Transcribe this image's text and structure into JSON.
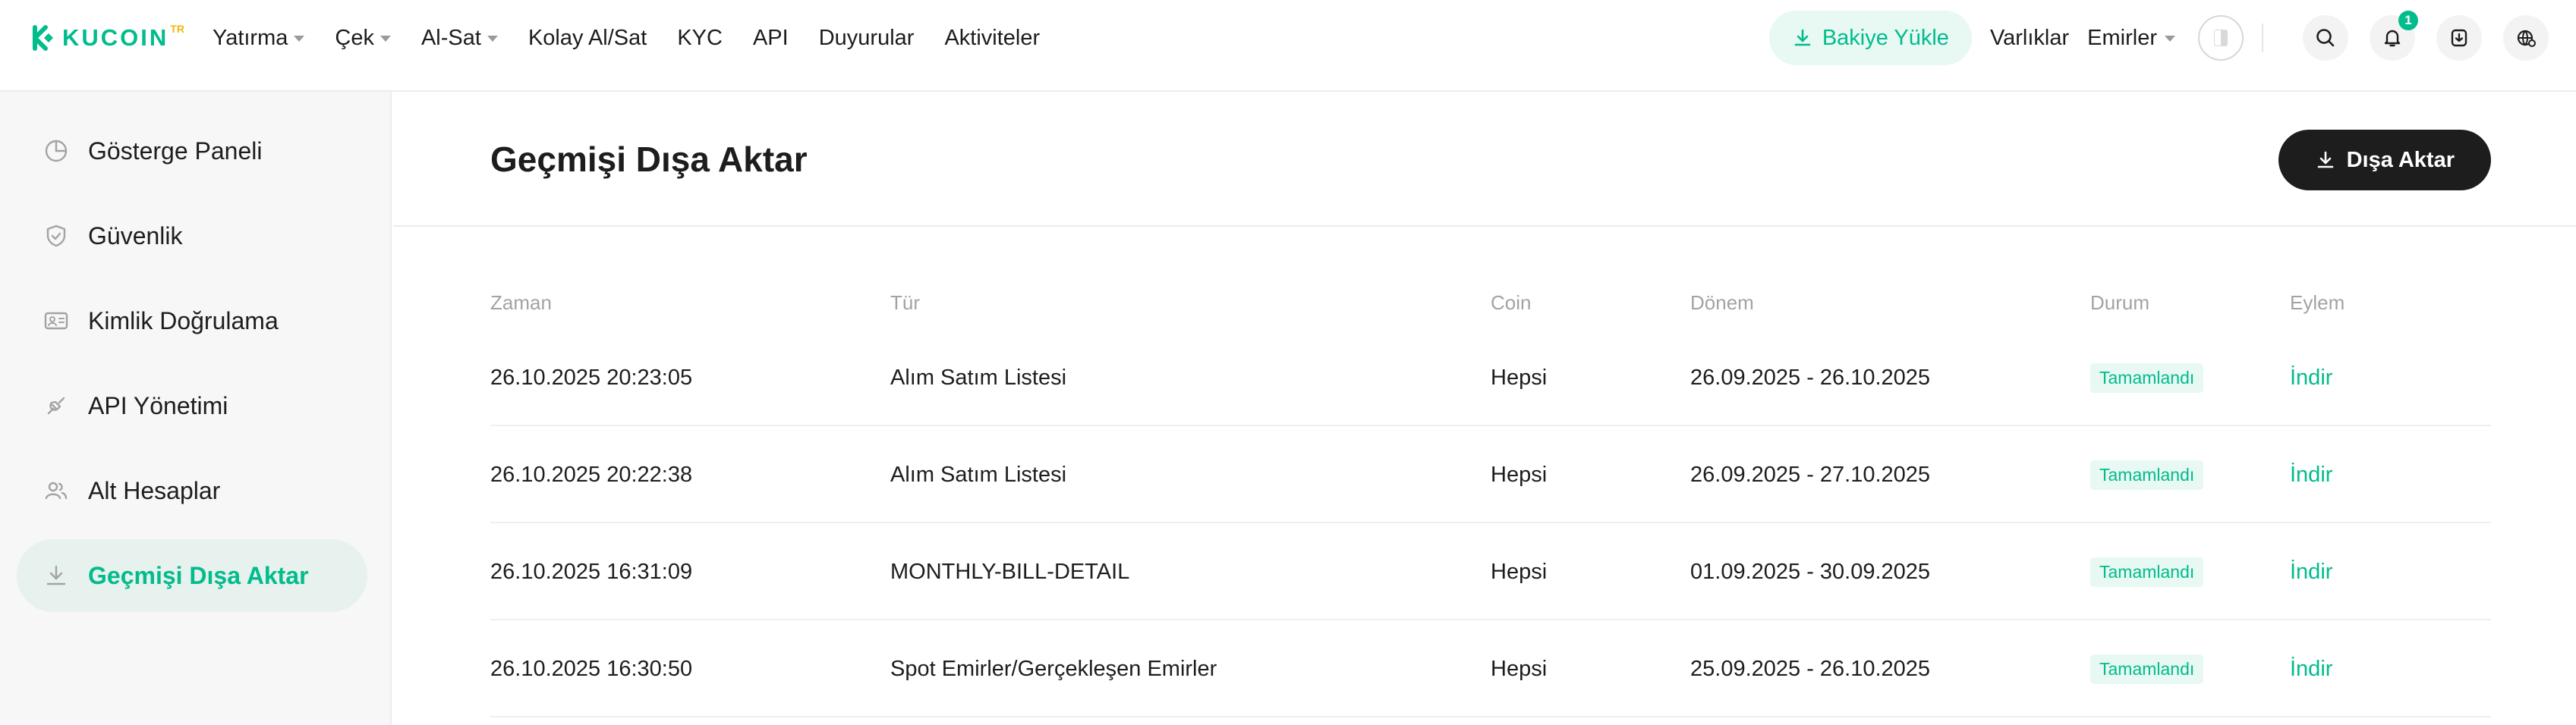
{
  "logo": {
    "text": "KUCOIN",
    "sup": "TR"
  },
  "nav": [
    {
      "label": "Yatırma",
      "dropdown": true
    },
    {
      "label": "Çek",
      "dropdown": true
    },
    {
      "label": "Al-Sat",
      "dropdown": true
    },
    {
      "label": "Kolay Al/Sat",
      "dropdown": false
    },
    {
      "label": "KYC",
      "dropdown": false
    },
    {
      "label": "API",
      "dropdown": false
    },
    {
      "label": "Duyurular",
      "dropdown": false
    },
    {
      "label": "Aktiviteler",
      "dropdown": false
    }
  ],
  "header_right": {
    "deposit_label": "Bakiye Yükle",
    "assets_label": "Varlıklar",
    "orders_label": "Emirler",
    "notification_count": "1"
  },
  "sidebar": {
    "items": [
      {
        "label": "Gösterge Paneli",
        "icon": "pie-chart-icon",
        "active": false
      },
      {
        "label": "Güvenlik",
        "icon": "shield-icon",
        "active": false
      },
      {
        "label": "Kimlik Doğrulama",
        "icon": "id-card-icon",
        "active": false
      },
      {
        "label": "API Yönetimi",
        "icon": "api-plug-icon",
        "active": false
      },
      {
        "label": "Alt Hesaplar",
        "icon": "users-icon",
        "active": false
      },
      {
        "label": "Geçmişi Dışa Aktar",
        "icon": "download-icon",
        "active": true
      }
    ]
  },
  "main": {
    "title": "Geçmişi Dışa Aktar",
    "export_button": "Dışa Aktar",
    "columns": [
      "Zaman",
      "Tür",
      "Coin",
      "Dönem",
      "Durum",
      "Eylem"
    ],
    "rows": [
      {
        "time": "26.10.2025 20:23:05",
        "type": "Alım Satım Listesi",
        "coin": "Hepsi",
        "period": "26.09.2025 - 26.10.2025",
        "status": "Tamamlandı",
        "action": "İndir"
      },
      {
        "time": "26.10.2025 20:22:38",
        "type": "Alım Satım Listesi",
        "coin": "Hepsi",
        "period": "26.09.2025 - 27.10.2025",
        "status": "Tamamlandı",
        "action": "İndir"
      },
      {
        "time": "26.10.2025 16:31:09",
        "type": "MONTHLY-BILL-DETAIL",
        "coin": "Hepsi",
        "period": "01.09.2025 - 30.09.2025",
        "status": "Tamamlandı",
        "action": "İndir"
      },
      {
        "time": "26.10.2025 16:30:50",
        "type": "Spot Emirler/Gerçekleşen Emirler",
        "coin": "Hepsi",
        "period": "25.09.2025 - 26.10.2025",
        "status": "Tamamlandı",
        "action": "İndir"
      }
    ]
  },
  "colors": {
    "accent": "#01bc8d",
    "dark": "#1d1d1d",
    "muted": "#a3a3a3"
  }
}
